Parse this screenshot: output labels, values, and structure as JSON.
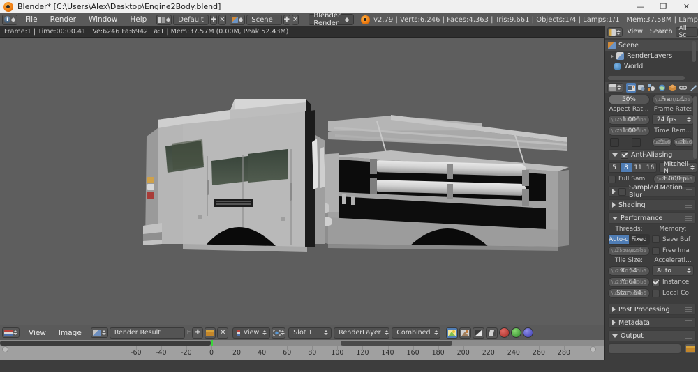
{
  "window": {
    "title": "Blender* [C:\\Users\\Alex\\Desktop\\Engine2Body.blend]",
    "minimize": "—",
    "maximize": "❐",
    "close": "✕"
  },
  "topbar": {
    "menus": [
      "File",
      "Render",
      "Window",
      "Help"
    ],
    "screen_layout": "Default",
    "scene_name": "Scene",
    "add_label": "✚",
    "remove_label": "✕",
    "engine": "Blender Render",
    "stats": "v2.79 | Verts:6,246 | Faces:4,363 | Tris:9,661 | Objects:1/4 | Lamps:1/1 | Mem:37.58M | Lamp"
  },
  "infostrip": {
    "text": "Frame:1 | Time:00:00.41 | Ve:6246 Fa:6942 La:1 | Mem:37.57M (0.00M, Peak 52.43M)"
  },
  "image_editor": {
    "menus": [
      "View",
      "Image"
    ],
    "image_name": "Render Result",
    "fake_user": "F",
    "new_label": "✚",
    "open_label": "📁",
    "unlink_label": "✕",
    "view_menu": "View",
    "slot": "Slot 1",
    "render_layer": "RenderLayer",
    "pass": "Combined",
    "channel_color": "#cf3a3a",
    "channel_green": "#3aa83a",
    "channel_blue": "#5a5ad0"
  },
  "timeline": {
    "ticks": [
      -60,
      -40,
      -20,
      0,
      20,
      40,
      60,
      80,
      100,
      120,
      140,
      160,
      180,
      200,
      220,
      240,
      260,
      280
    ],
    "current_frame": 0,
    "playhead_color": "#3bd83b"
  },
  "outliner": {
    "menus": [
      "View",
      "Search"
    ],
    "display_mode": "All Sc",
    "items": [
      {
        "label": "Scene",
        "icon": "scene-icon",
        "selected": true
      },
      {
        "label": "RenderLayers",
        "icon": "renderlayers-icon",
        "selected": false
      },
      {
        "label": "World",
        "icon": "world-icon",
        "selected": false
      }
    ]
  },
  "properties": {
    "tabs": [
      {
        "name": "render-tab",
        "active": true,
        "color": "#c8c8c8"
      },
      {
        "name": "render-layers-tab",
        "active": false,
        "color": "#9aa8b8"
      },
      {
        "name": "scene-tab",
        "active": false,
        "color": "#b8b8b8"
      },
      {
        "name": "world-tab",
        "active": false,
        "color": "#5f93c8"
      },
      {
        "name": "object-tab",
        "active": false,
        "color": "#d08a3a"
      },
      {
        "name": "constraints-tab",
        "active": false,
        "color": "#b0b0b0"
      },
      {
        "name": "modifiers-tab",
        "active": false,
        "color": "#8fb4d8"
      }
    ],
    "dimensions": {
      "resolution_percent": "50%",
      "frames_label": "Fram: 1",
      "aspect_label": "Aspect Rat...",
      "aspect_x": ": 1.000",
      "aspect_y": ": 1.000",
      "frame_rate_label": "Frame Rate:",
      "frame_rate": "24 fps",
      "time_remap_label": "Time Rem...",
      "time_remap_old": "1",
      "time_remap_new": "1"
    },
    "anti_aliasing": {
      "title": "Anti-Aliasing",
      "enabled": true,
      "samples": [
        "5",
        "8",
        "11",
        "16"
      ],
      "selected_sample": "8",
      "filter": "Mitchell-N",
      "full_sample_label": "Full Sam",
      "full_sample": false,
      "filter_size": "1.000 p"
    },
    "sampled_motion_blur": {
      "title": "Sampled Motion Blur",
      "enabled": false,
      "open": false
    },
    "shading": {
      "title": "Shading",
      "open": false
    },
    "performance": {
      "title": "Performance",
      "open": true,
      "threads_label": "Threads:",
      "threads_modes": [
        "Auto-d",
        "Fixed"
      ],
      "threads_selected": "Auto-d",
      "threads_count": "Threa: 4",
      "memory_label": "Memory:",
      "save_buffers_label": "Save Buf",
      "save_buffers": false,
      "free_image_label": "Free Ima",
      "free_image": false,
      "tile_size_label": "Tile Size:",
      "tile_x": "X:   64",
      "tile_y": "Y:   64",
      "start_resolution": "Star: 64",
      "acceleration_label": "Accelerati...",
      "acceleration": "Auto",
      "instances_label": "Instance",
      "instances": true,
      "local_coords_label": "Local Co",
      "local_coords": false
    },
    "post_processing": {
      "title": "Post Processing",
      "open": false
    },
    "metadata": {
      "title": "Metadata",
      "open": false
    },
    "output": {
      "title": "Output",
      "open": true
    }
  }
}
